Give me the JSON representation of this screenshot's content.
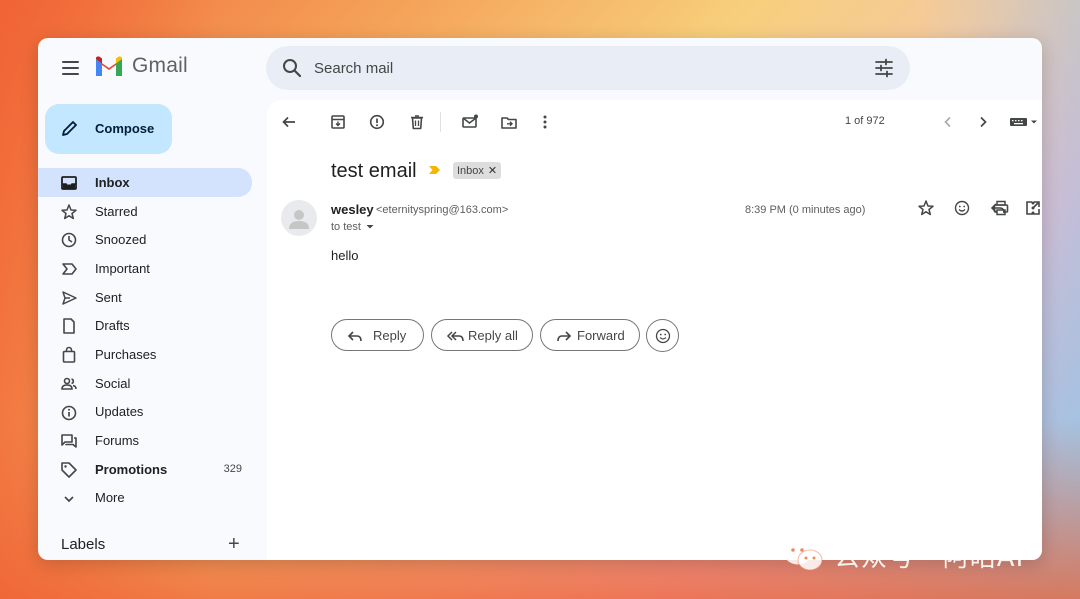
{
  "app": {
    "name": "Gmail"
  },
  "search": {
    "placeholder": "Search mail"
  },
  "sidebar": {
    "compose_label": "Compose",
    "items": [
      {
        "label": "Inbox",
        "icon": "inbox-icon",
        "active": true,
        "count": ""
      },
      {
        "label": "Starred",
        "icon": "star-icon",
        "count": ""
      },
      {
        "label": "Snoozed",
        "icon": "clock-icon",
        "count": ""
      },
      {
        "label": "Important",
        "icon": "important-icon",
        "count": ""
      },
      {
        "label": "Sent",
        "icon": "send-icon",
        "count": ""
      },
      {
        "label": "Drafts",
        "icon": "draft-icon",
        "count": ""
      },
      {
        "label": "Purchases",
        "icon": "shopping-bag-icon",
        "count": ""
      },
      {
        "label": "Social",
        "icon": "people-icon",
        "count": ""
      },
      {
        "label": "Updates",
        "icon": "info-icon",
        "count": ""
      },
      {
        "label": "Forums",
        "icon": "forum-icon",
        "count": ""
      },
      {
        "label": "Promotions",
        "icon": "tag-icon",
        "count": "329",
        "bold": true
      },
      {
        "label": "More",
        "icon": "chevron-down-icon",
        "count": ""
      }
    ],
    "labels_header": "Labels"
  },
  "toolbar": {
    "pager": "1 of 972"
  },
  "email": {
    "subject": "test email",
    "label_chip": "Inbox",
    "sender_name": "wesley",
    "sender_email": "<eternityspring@163.com>",
    "to_line": "to test",
    "time": "8:39 PM (0 minutes ago)",
    "body": "hello"
  },
  "actions": {
    "reply": "Reply",
    "reply_all": "Reply all",
    "forward": "Forward"
  },
  "watermark": {
    "text": "公众号 · 阿皓AI"
  },
  "colors": {
    "compose_bg": "#c2e7ff",
    "active_nav_bg": "#d3e3fd",
    "search_bg": "#e9eef6",
    "important_marker": "#f4b400"
  }
}
